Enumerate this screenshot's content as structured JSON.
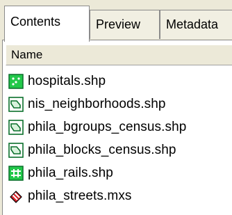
{
  "tabs": [
    {
      "label": "Contents",
      "active": true
    },
    {
      "label": "Preview",
      "active": false
    },
    {
      "label": "Metadata",
      "active": false
    }
  ],
  "list": {
    "header": "Name",
    "items": [
      {
        "label": "hospitals.shp",
        "icon": "point-layer-icon"
      },
      {
        "label": "nis_neighborhoods.shp",
        "icon": "polygon-layer-icon"
      },
      {
        "label": "phila_bgroups_census.shp",
        "icon": "polygon-layer-icon"
      },
      {
        "label": "phila_blocks_census.shp",
        "icon": "polygon-layer-icon"
      },
      {
        "label": "phila_rails.shp",
        "icon": "line-layer-icon"
      },
      {
        "label": "phila_streets.mxs",
        "icon": "mxs-document-icon"
      }
    ]
  }
}
